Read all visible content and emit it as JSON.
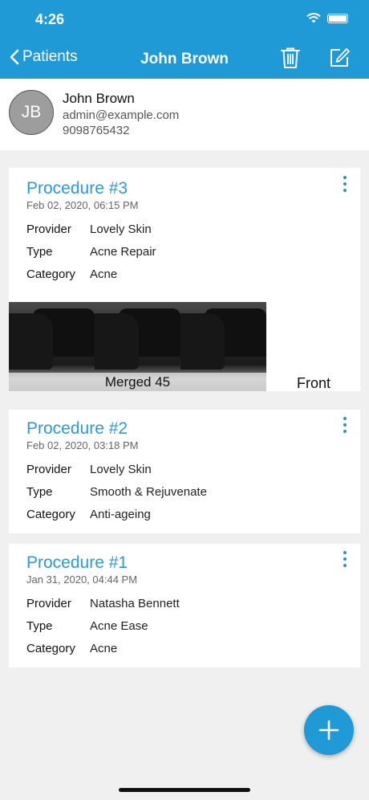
{
  "status": {
    "time": "4:26"
  },
  "nav": {
    "back_label": "Patients",
    "title": "John Brown"
  },
  "patient": {
    "initials": "JB",
    "name": "John Brown",
    "email": "admin@example.com",
    "phone": "9098765432"
  },
  "labels": {
    "provider": "Provider",
    "type": "Type",
    "category": "Category"
  },
  "procedures": [
    {
      "title": "Procedure #3",
      "date": "Feb 02, 2020, 06:15 PM",
      "provider": "Lovely Skin",
      "type": "Acne Repair",
      "category": "Acne",
      "photo_caption": "Merged 45",
      "photo_label": "Front"
    },
    {
      "title": "Procedure #2",
      "date": "Feb 02, 2020, 03:18 PM",
      "provider": "Lovely Skin",
      "type": "Smooth & Rejuvenate",
      "category": "Anti-ageing"
    },
    {
      "title": "Procedure #1",
      "date": "Jan 31, 2020, 04:44 PM",
      "provider": "Natasha Bennett",
      "type": "Acne Ease",
      "category": "Acne"
    }
  ],
  "colors": {
    "accent": "#1f9ad6",
    "title": "#2a9bd3",
    "background": "#f0f0f0"
  },
  "icons": [
    "chevron-left-icon",
    "trash-icon",
    "edit-icon",
    "more-vertical-icon",
    "plus-icon",
    "wifi-icon",
    "battery-icon"
  ]
}
